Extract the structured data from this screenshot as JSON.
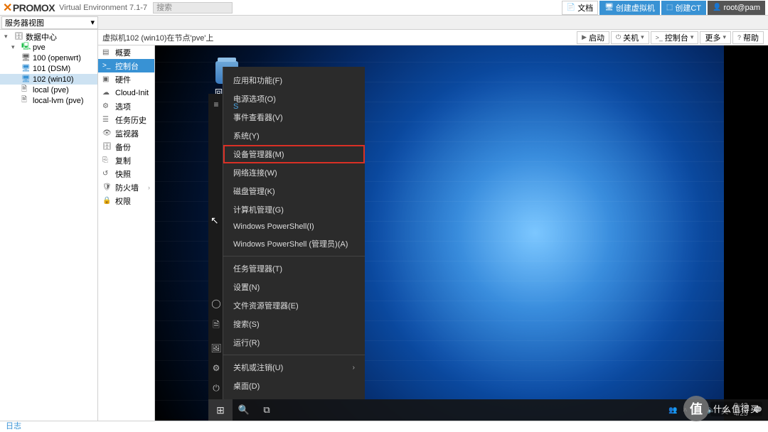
{
  "header": {
    "logo_pro": "PRO",
    "logo_mox": "MOX",
    "ve_label": "Virtual Environment 7.1-7",
    "search_placeholder": "搜索",
    "docs": "文档",
    "create_vm": "创建虚拟机",
    "create_ct": "创建CT",
    "user": "root@pam"
  },
  "view_selector": "服务器视图",
  "tree": {
    "dc": "数据中心",
    "node": "pve",
    "vm100": "100 (openwrt)",
    "vm101": "101 (DSM)",
    "vm102": "102 (win10)",
    "local": "local (pve)",
    "localvm": "local-lvm (pve)"
  },
  "content": {
    "title": "虚拟机102 (win10)在节点'pve'上",
    "btn_start": "启动",
    "btn_shutdown": "关机",
    "btn_console": "控制台",
    "btn_more": "更多",
    "btn_help": "帮助"
  },
  "submenu": {
    "summary": "概要",
    "console": "控制台",
    "hardware": "硬件",
    "cloudinit": "Cloud-Init",
    "options": "选项",
    "taskhistory": "任务历史",
    "monitor": "监视器",
    "backup": "备份",
    "replication": "复制",
    "snapshot": "快照",
    "firewall": "防火墙",
    "permissions": "权限"
  },
  "desktop": {
    "recycle": "回收站",
    "start_letter": "S"
  },
  "ctx": {
    "apps": "应用和功能(F)",
    "power": "电源选项(O)",
    "events": "事件查看器(V)",
    "system": "系统(Y)",
    "devmgr": "设备管理器(M)",
    "network": "网络连接(W)",
    "disk": "磁盘管理(K)",
    "compmgmt": "计算机管理(G)",
    "ps": "Windows PowerShell(I)",
    "psadmin": "Windows PowerShell (管理员)(A)",
    "taskmgr": "任务管理器(T)",
    "settings": "设置(N)",
    "explorer": "文件资源管理器(E)",
    "search": "搜索(S)",
    "run": "运行(R)",
    "shutdown": "关机或注销(U)",
    "desktop": "桌面(D)"
  },
  "tray": {
    "ime": "英",
    "time": "8:43",
    "date": "4/25"
  },
  "log_label": "日志",
  "watermark": {
    "char": "值",
    "text": "什么值得买"
  }
}
